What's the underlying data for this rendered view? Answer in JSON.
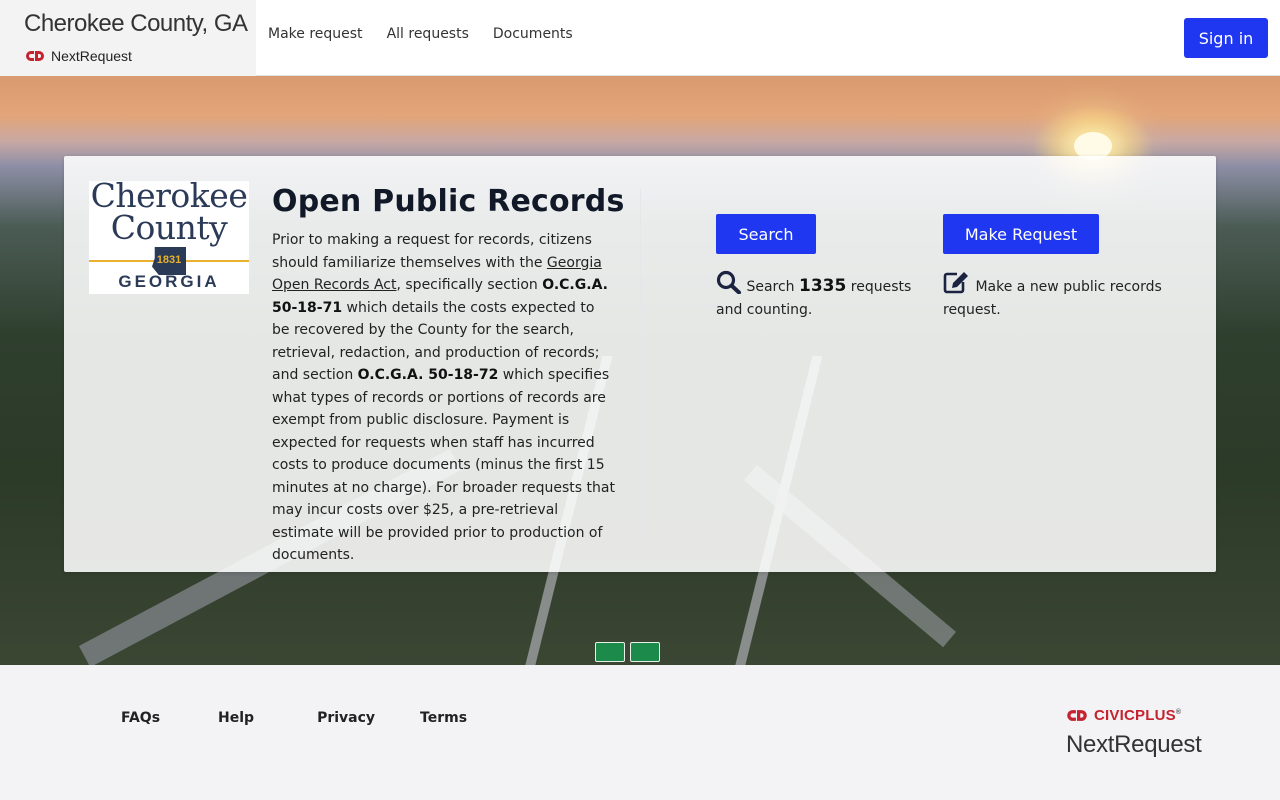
{
  "header": {
    "brand_title": "Cherokee County, GA",
    "brand_sub": "NextRequest",
    "nav": [
      "Make request",
      "All requests",
      "Documents"
    ],
    "signin_label": "Sign in"
  },
  "card": {
    "logo": {
      "line1": "Cherokee",
      "line2": "County",
      "year": "1831",
      "state": "GEORGIA"
    },
    "title": "Open Public Records",
    "intro": {
      "p1": "Prior to making a request for records, citizens should familiarize themselves with the ",
      "link": "Georgia Open Records Act",
      "p2": ", specifically section ",
      "code1": "O.C.G.A. 50-18-71",
      "p3": " which details the costs expected to be recovered by the County for the search, retrieval, redaction, and production of records; and section ",
      "code2": "O.C.G.A. 50-18-72",
      "p4": " which specifies what types of records or portions of records are exempt from public disclosure. Payment is expected for requests when staff has incurred costs to produce documents (minus the first 15 minutes at no charge). For broader requests that may incur costs over $25, a pre-retrieval estimate will be provided prior to production of documents."
    },
    "search": {
      "button_label": "Search",
      "text_before": "Search ",
      "count": "1335",
      "text_after": " requests and counting."
    },
    "request": {
      "button_label": "Make Request",
      "text": "Make a new public records request."
    }
  },
  "footer": {
    "links": [
      "FAQs",
      "Help",
      "Privacy",
      "Terms"
    ],
    "civic_part1": "CIVIC",
    "civic_part2": "PLUS",
    "civic_mark": "®",
    "product": "NextRequest"
  },
  "colors": {
    "primary": "#1f37f0",
    "brand_red": "#c5232f",
    "logo_navy": "#2b3a57",
    "logo_gold": "#e8b22e"
  },
  "icons": {
    "search": "search-icon",
    "edit": "edit-icon",
    "civicplus_logo": "civicplus-logo-icon",
    "nextrequest_logo": "nextrequest-logo-icon"
  }
}
